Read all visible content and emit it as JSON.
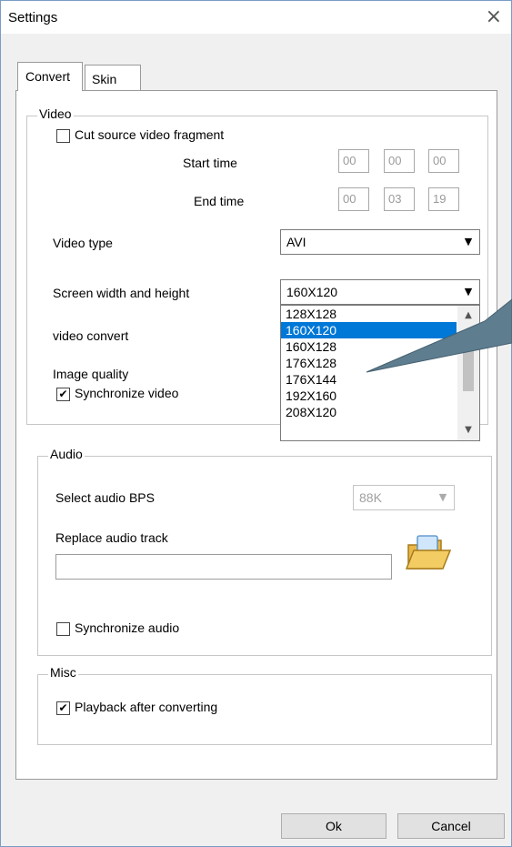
{
  "window": {
    "title": "Settings",
    "close_glyph": "×"
  },
  "tabs": [
    {
      "label": "Convert",
      "active": true
    },
    {
      "label": "Skin",
      "active": false
    }
  ],
  "video": {
    "group_label": "Video",
    "cut_fragment": {
      "label": "Cut source video fragment",
      "checked": false
    },
    "start_time": {
      "label": "Start time",
      "h": "00",
      "m": "00",
      "s": "00"
    },
    "end_time": {
      "label": "End time",
      "h": "00",
      "m": "03",
      "s": "19"
    },
    "video_type": {
      "label": "Video type",
      "value": "AVI"
    },
    "screen_size": {
      "label": "Screen width and height",
      "value": "160X120",
      "options": [
        "128X128",
        "160X120",
        "160X128",
        "176X128",
        "176X144",
        "192X160",
        "208X120"
      ],
      "selected_index": 1
    },
    "video_convert": {
      "label": "video convert"
    },
    "image_quality": {
      "label": "Image quality"
    },
    "synchronize_video": {
      "label": "Synchronize video",
      "checked": true
    }
  },
  "audio": {
    "group_label": "Audio",
    "bps": {
      "label": "Select audio BPS",
      "value": "88K"
    },
    "replace_track": {
      "label": "Replace audio track",
      "value": ""
    },
    "synchronize_audio": {
      "label": "Synchronize audio",
      "checked": false
    }
  },
  "misc": {
    "group_label": "Misc",
    "playback": {
      "label": "Playback after converting",
      "checked": true
    }
  },
  "buttons": {
    "ok": "Ok",
    "cancel": "Cancel"
  },
  "colors": {
    "selection": "#0078d7",
    "callout": "#5e7d8f"
  },
  "icons": {
    "close": "close-icon",
    "folder": "open-folder-icon",
    "dropdown": "chevron-down-icon"
  }
}
